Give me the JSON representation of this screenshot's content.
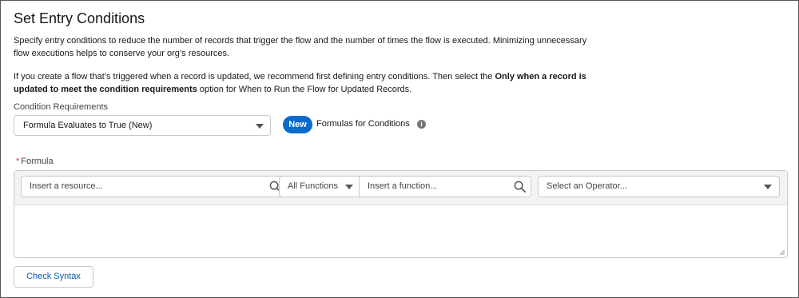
{
  "page": {
    "title": "Set Entry Conditions",
    "description1": "Specify entry conditions to reduce the number of records that trigger the flow and the number of times the flow is executed. Minimizing unnecessary flow executions helps to conserve your org’s resources.",
    "description2_pre": "If you create a flow that’s triggered when a record is updated, we recommend first defining entry conditions. Then select the ",
    "description2_bold": "Only when a record is updated to meet the condition requirements",
    "description2_post": " option for When to Run the Flow for Updated Records."
  },
  "conditions": {
    "label": "Condition Requirements",
    "selected": "Formula Evaluates to True (New)",
    "badge": "New",
    "badge_text": "Formulas for Conditions",
    "info_icon": "info-icon"
  },
  "formula": {
    "required_marker": "*",
    "label": "Formula",
    "resource_placeholder": "Insert a resource...",
    "function_category": "All Functions",
    "function_placeholder": "Insert a function...",
    "operator_placeholder": "Select an Operator...",
    "value": ""
  },
  "actions": {
    "check_syntax": "Check Syntax"
  },
  "colors": {
    "brand_blue": "#0b6bcb",
    "link_blue": "#0b5cab",
    "required_red": "#c23934"
  }
}
